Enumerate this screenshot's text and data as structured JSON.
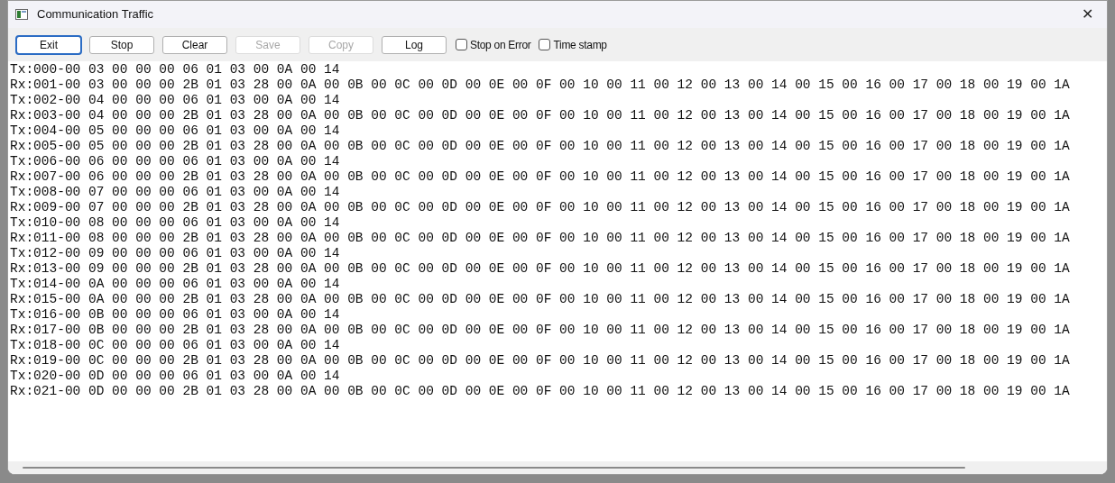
{
  "window": {
    "title": "Communication Traffic",
    "close": "✕"
  },
  "toolbar": {
    "buttons": [
      {
        "label": "Exit",
        "disabled": false,
        "focused": true
      },
      {
        "label": "Stop",
        "disabled": false,
        "focused": false
      },
      {
        "label": "Clear",
        "disabled": false,
        "focused": false
      },
      {
        "label": "Save",
        "disabled": true,
        "focused": false
      },
      {
        "label": "Copy",
        "disabled": true,
        "focused": false
      },
      {
        "label": "Log",
        "disabled": false,
        "focused": false
      }
    ],
    "checkboxes": [
      {
        "label": "Stop on Error",
        "checked": false
      },
      {
        "label": "Time stamp",
        "checked": false
      }
    ]
  },
  "traffic_lines": [
    "Tx:000-00 03 00 00 00 06 01 03 00 0A 00 14",
    "Rx:001-00 03 00 00 00 2B 01 03 28 00 0A 00 0B 00 0C 00 0D 00 0E 00 0F 00 10 00 11 00 12 00 13 00 14 00 15 00 16 00 17 00 18 00 19 00 1A",
    "Tx:002-00 04 00 00 00 06 01 03 00 0A 00 14",
    "Rx:003-00 04 00 00 00 2B 01 03 28 00 0A 00 0B 00 0C 00 0D 00 0E 00 0F 00 10 00 11 00 12 00 13 00 14 00 15 00 16 00 17 00 18 00 19 00 1A",
    "Tx:004-00 05 00 00 00 06 01 03 00 0A 00 14",
    "Rx:005-00 05 00 00 00 2B 01 03 28 00 0A 00 0B 00 0C 00 0D 00 0E 00 0F 00 10 00 11 00 12 00 13 00 14 00 15 00 16 00 17 00 18 00 19 00 1A",
    "Tx:006-00 06 00 00 00 06 01 03 00 0A 00 14",
    "Rx:007-00 06 00 00 00 2B 01 03 28 00 0A 00 0B 00 0C 00 0D 00 0E 00 0F 00 10 00 11 00 12 00 13 00 14 00 15 00 16 00 17 00 18 00 19 00 1A",
    "Tx:008-00 07 00 00 00 06 01 03 00 0A 00 14",
    "Rx:009-00 07 00 00 00 2B 01 03 28 00 0A 00 0B 00 0C 00 0D 00 0E 00 0F 00 10 00 11 00 12 00 13 00 14 00 15 00 16 00 17 00 18 00 19 00 1A",
    "Tx:010-00 08 00 00 00 06 01 03 00 0A 00 14",
    "Rx:011-00 08 00 00 00 2B 01 03 28 00 0A 00 0B 00 0C 00 0D 00 0E 00 0F 00 10 00 11 00 12 00 13 00 14 00 15 00 16 00 17 00 18 00 19 00 1A",
    "Tx:012-00 09 00 00 00 06 01 03 00 0A 00 14",
    "Rx:013-00 09 00 00 00 2B 01 03 28 00 0A 00 0B 00 0C 00 0D 00 0E 00 0F 00 10 00 11 00 12 00 13 00 14 00 15 00 16 00 17 00 18 00 19 00 1A",
    "Tx:014-00 0A 00 00 00 06 01 03 00 0A 00 14",
    "Rx:015-00 0A 00 00 00 2B 01 03 28 00 0A 00 0B 00 0C 00 0D 00 0E 00 0F 00 10 00 11 00 12 00 13 00 14 00 15 00 16 00 17 00 18 00 19 00 1A",
    "Tx:016-00 0B 00 00 00 06 01 03 00 0A 00 14",
    "Rx:017-00 0B 00 00 00 2B 01 03 28 00 0A 00 0B 00 0C 00 0D 00 0E 00 0F 00 10 00 11 00 12 00 13 00 14 00 15 00 16 00 17 00 18 00 19 00 1A",
    "Tx:018-00 0C 00 00 00 06 01 03 00 0A 00 14",
    "Rx:019-00 0C 00 00 00 2B 01 03 28 00 0A 00 0B 00 0C 00 0D 00 0E 00 0F 00 10 00 11 00 12 00 13 00 14 00 15 00 16 00 17 00 18 00 19 00 1A",
    "Tx:020-00 0D 00 00 00 06 01 03 00 0A 00 14",
    "Rx:021-00 0D 00 00 00 2B 01 03 28 00 0A 00 0B 00 0C 00 0D 00 0E 00 0F 00 10 00 11 00 12 00 13 00 14 00 15 00 16 00 17 00 18 00 19 00 1A"
  ]
}
